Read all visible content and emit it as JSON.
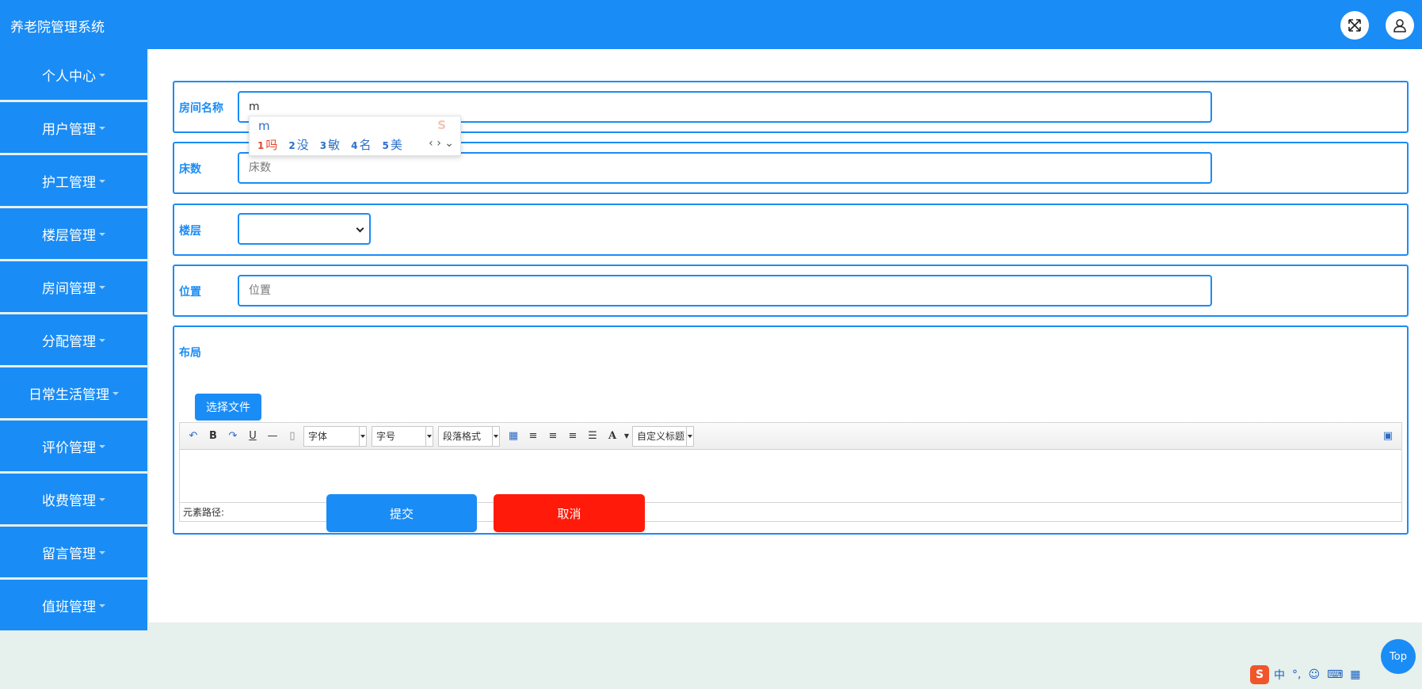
{
  "app": {
    "title": "养老院管理系统"
  },
  "header": {
    "fullscreen_icon": "expand-arrows-icon",
    "user_icon": "user-icon"
  },
  "sidebar": {
    "items": [
      {
        "label": "个人中心"
      },
      {
        "label": "用户管理"
      },
      {
        "label": "护工管理"
      },
      {
        "label": "楼层管理"
      },
      {
        "label": "房间管理"
      },
      {
        "label": "分配管理"
      },
      {
        "label": "日常生活管理"
      },
      {
        "label": "评价管理"
      },
      {
        "label": "收费管理"
      },
      {
        "label": "留言管理"
      },
      {
        "label": "值班管理"
      }
    ]
  },
  "form": {
    "room_name": {
      "label": "房间名称",
      "value": "m"
    },
    "beds": {
      "label": "床数",
      "placeholder": "床数"
    },
    "floor": {
      "label": "楼层",
      "value": ""
    },
    "location": {
      "label": "位置",
      "placeholder": "位置"
    },
    "layout": {
      "label": "布局",
      "upload_label": "选择文件",
      "toolbar": {
        "font_family": "字体",
        "font_size": "字号",
        "paragraph": "段落格式",
        "custom_title": "自定义标题"
      },
      "element_path": "元素路径:"
    }
  },
  "ime": {
    "composition": "m",
    "candidates": [
      {
        "num": "1",
        "text": "吗"
      },
      {
        "num": "2",
        "text": "没"
      },
      {
        "num": "3",
        "text": "敏"
      },
      {
        "num": "4",
        "text": "名"
      },
      {
        "num": "5",
        "text": "美"
      }
    ]
  },
  "actions": {
    "submit": "提交",
    "cancel": "取消"
  },
  "colors": {
    "primary": "#1a8cf5",
    "danger": "#ff1a0a",
    "page_bg": "#e6f0ec"
  },
  "back_to_top": "Top",
  "taskbar": {
    "ime_mode": "中",
    "ime_logo": "S"
  }
}
